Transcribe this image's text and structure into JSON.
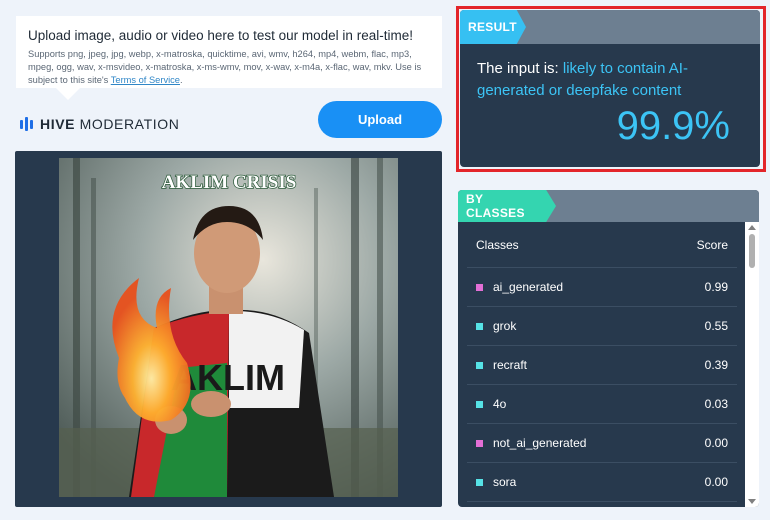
{
  "upload_info": {
    "title": "Upload image, audio or video here to test our model in real-time!",
    "description": "Supports png, jpeg, jpg, webp, x-matroska, quicktime, avi, wmv, h264, mp4, webm, flac, mp3, mpeg, ogg, wav, x-msvideo, x-matroska, x-ms-wmv, mov, x-wav, x-m4a, x-flac, wav, mkv. Use is subject to this site's",
    "tos_link": "Terms of Service",
    "tos_suffix": "."
  },
  "logo": {
    "bold": "HIVE",
    "light": " MODERATION"
  },
  "upload_button": "Upload",
  "image": {
    "overlay_title": "AKLIM CRISIS",
    "shirt_text": "AKLIM"
  },
  "result": {
    "tag": "RESULT",
    "prefix": "The input is: ",
    "verdict": "likely to contain AI-generated or deepfake content",
    "score": "99.9%",
    "accent": "#36c0f2"
  },
  "by_classes": {
    "tag": "BY CLASSES",
    "accent": "#34d5b0",
    "col_classes": "Classes",
    "col_score": "Score",
    "rows": [
      {
        "name": "ai_generated",
        "score": "0.99",
        "color": "#e36fd6"
      },
      {
        "name": "grok",
        "score": "0.55",
        "color": "#56e2e6"
      },
      {
        "name": "recraft",
        "score": "0.39",
        "color": "#56e2e6"
      },
      {
        "name": "4o",
        "score": "0.03",
        "color": "#56e2e6"
      },
      {
        "name": "not_ai_generated",
        "score": "0.00",
        "color": "#e36fd6"
      },
      {
        "name": "sora",
        "score": "0.00",
        "color": "#56e2e6"
      }
    ]
  },
  "highlight_color": "#e3252a"
}
